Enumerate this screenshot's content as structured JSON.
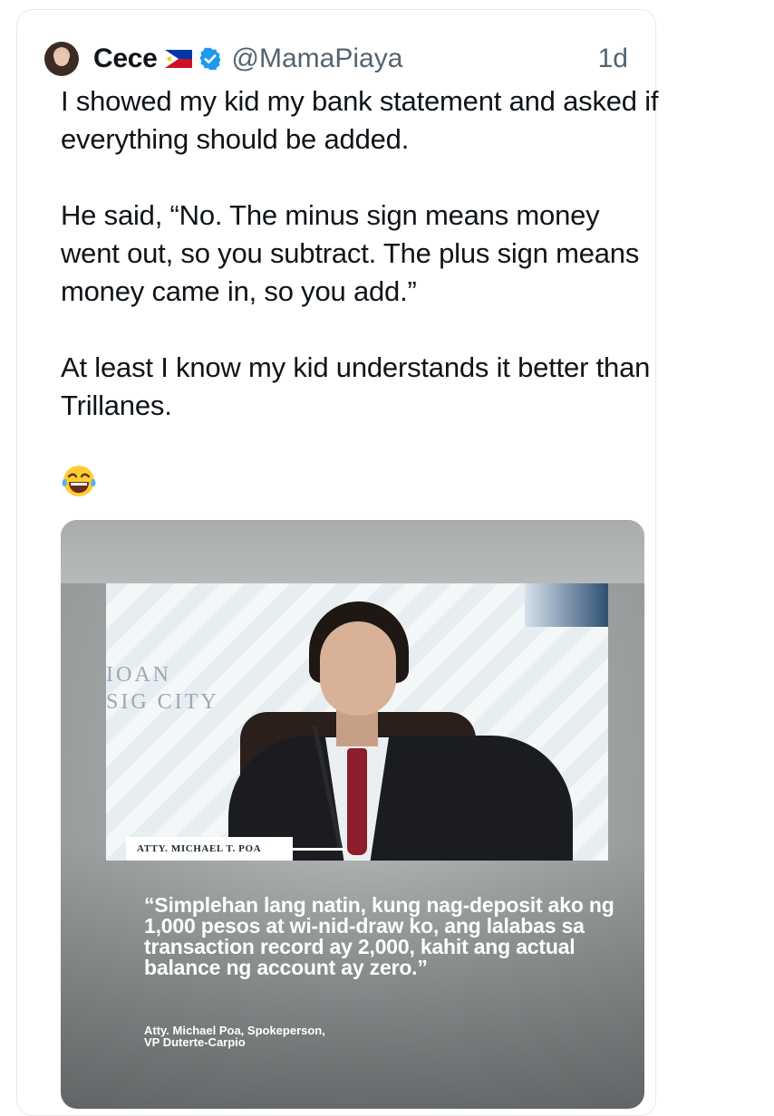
{
  "tweet": {
    "author_name": "Cece",
    "handle": "@MamaPiaya",
    "time_ago": "1d",
    "paragraphs": [
      "I showed my kid my bank statement and asked if everything should be added.",
      "He said, “No. The minus sign means money went out, so you subtract. The plus sign means money came in, so you add.”",
      "At least I know my kid understands it better than Trillanes."
    ],
    "emoji": "😂"
  },
  "media": {
    "wall_text_line1": "IOAN",
    "wall_text_line2": "SIG CITY",
    "nameplate": "ATTY. MICHAEL T. POA",
    "quote": "“Simplehan lang natin, kung nag-deposit ako ng 1,000 pesos at wi-nid-draw ko, ang lalabas sa transaction record ay 2,000, kahit ang actual balance ng account ay zero.”",
    "attribution_line1": "Atty. Michael Poa, Spokeperson,",
    "attribution_line2": "VP Duterte-Carpio"
  },
  "colors": {
    "verified": "#1d9bf0",
    "muted_text": "#536471",
    "tie": "#8c1f2b"
  }
}
